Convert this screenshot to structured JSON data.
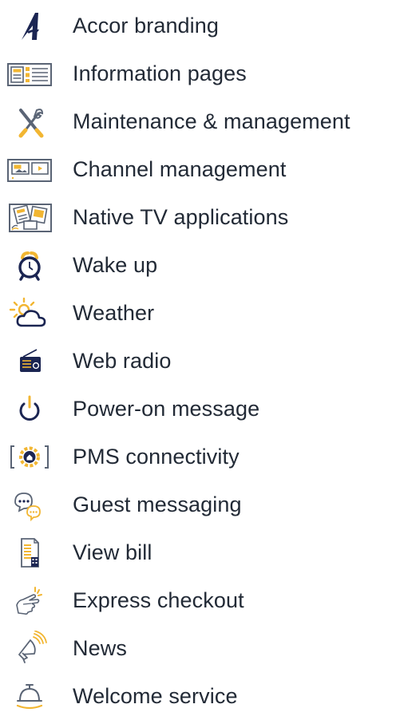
{
  "colors": {
    "text": "#222a36",
    "navy": "#1b2552",
    "accent": "#f2b632",
    "icon_line": "#5a6475"
  },
  "features": [
    {
      "label": "Accor branding",
      "icon": "accor-logo-icon"
    },
    {
      "label": "Information pages",
      "icon": "information-pages-icon"
    },
    {
      "label": "Maintenance & management",
      "icon": "tools-icon"
    },
    {
      "label": "Channel management",
      "icon": "channel-management-icon"
    },
    {
      "label": "Native TV applications",
      "icon": "tv-apps-icon"
    },
    {
      "label": "Wake up",
      "icon": "alarm-clock-icon"
    },
    {
      "label": "Weather",
      "icon": "weather-icon"
    },
    {
      "label": "Web radio",
      "icon": "radio-icon"
    },
    {
      "label": "Power-on message",
      "icon": "power-icon"
    },
    {
      "label": "PMS connectivity",
      "icon": "pms-connectivity-icon"
    },
    {
      "label": "Guest messaging",
      "icon": "chat-bubbles-icon"
    },
    {
      "label": "View bill",
      "icon": "bill-icon"
    },
    {
      "label": "Express checkout",
      "icon": "pointing-hand-icon"
    },
    {
      "label": "News",
      "icon": "megaphone-icon"
    },
    {
      "label": "Welcome service",
      "icon": "service-bell-icon"
    }
  ]
}
